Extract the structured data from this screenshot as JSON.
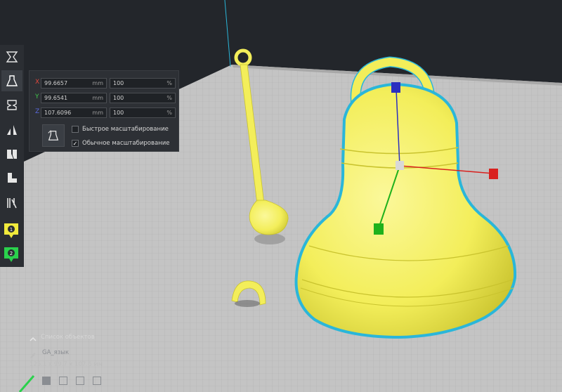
{
  "scale": {
    "rows": [
      {
        "axis": "X",
        "axis_color": "#e0463c",
        "mm_value": "99.6657",
        "mm_unit": "mm",
        "percent_value": "100",
        "percent_unit": "%"
      },
      {
        "axis": "Y",
        "axis_color": "#3fc24a",
        "mm_value": "99.6541",
        "mm_unit": "mm",
        "percent_value": "100",
        "percent_unit": "%"
      },
      {
        "axis": "Z",
        "axis_color": "#5a6ae0",
        "mm_value": "107.6096",
        "mm_unit": "mm",
        "percent_value": "100",
        "percent_unit": "%"
      }
    ],
    "options": [
      {
        "label": "Быстрое масштабирование",
        "checked": false,
        "mark": ""
      },
      {
        "label": "Обычное масштабирование",
        "checked": true,
        "mark": "✓"
      }
    ]
  },
  "toolbar": {
    "tools": [
      "move-tool",
      "scale-tool",
      "rotate-tool",
      "mirror-tool",
      "per-model-settings-tool",
      "support-blocker-tool",
      "custom-supports-tool"
    ],
    "active": "scale-tool",
    "extruder_badges": [
      {
        "number": "1",
        "color": "#f1ea3c"
      },
      {
        "number": "2",
        "color": "#2ad14c"
      }
    ]
  },
  "object_list": {
    "title": "Список объектов",
    "object_name": "GA_язык",
    "dimensions": "125.1 x 99.7 x 107.6 мм"
  },
  "colors": {
    "background": "#23262b",
    "build_plate": "#c4c4c4",
    "model": "#f6f16a",
    "model_outline": "#2ab6d9",
    "panel": "#2d3035",
    "gizmo_x": "#d9211e",
    "gizmo_y": "#1fb11c",
    "gizmo_z": "#2a2ec0"
  }
}
